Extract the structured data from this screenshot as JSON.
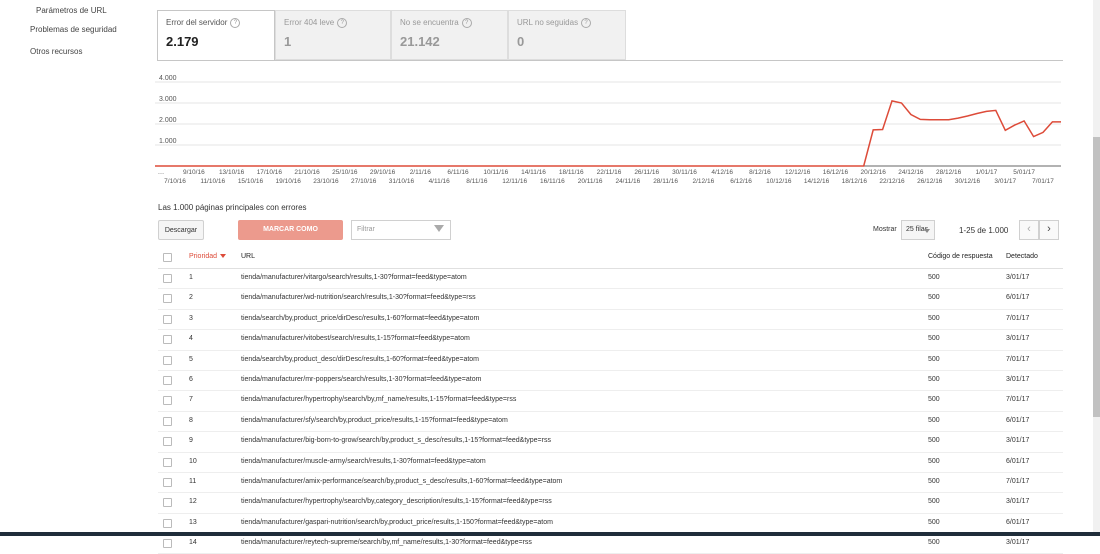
{
  "sidebar": {
    "items": [
      {
        "label": "Parámetros de URL"
      },
      {
        "label": "Problemas de seguridad"
      },
      {
        "label": "Otros recursos"
      }
    ]
  },
  "tabs": [
    {
      "label": "Error del servidor",
      "value": "2.179",
      "active": true
    },
    {
      "label": "Error 404 leve",
      "value": "1",
      "active": false
    },
    {
      "label": "No se encuentra",
      "value": "21.142",
      "active": false
    },
    {
      "label": "URL no seguidas",
      "value": "0",
      "active": false
    }
  ],
  "help_icon": "?",
  "chart_data": {
    "type": "line",
    "y_ticks": [
      "1.000",
      "2.000",
      "3.000",
      "4.000"
    ],
    "ylim": [
      0,
      4000
    ],
    "grid": true,
    "x_labels_top": [
      "…",
      "9/10/16",
      "13/10/16",
      "17/10/16",
      "21/10/16",
      "25/10/16",
      "29/10/16",
      "2/11/16",
      "6/11/16",
      "10/11/16",
      "14/11/16",
      "18/11/16",
      "22/11/16",
      "26/11/16",
      "30/11/16",
      "4/12/16",
      "8/12/16",
      "12/12/16",
      "16/12/16",
      "20/12/16",
      "24/12/16",
      "28/12/16",
      "1/01/17",
      "5/01/17"
    ],
    "x_labels_bottom": [
      "7/10/16",
      "11/10/16",
      "15/10/16",
      "19/10/16",
      "23/10/16",
      "27/10/16",
      "31/10/16",
      "4/11/16",
      "8/11/16",
      "12/11/16",
      "16/11/16",
      "20/11/16",
      "24/11/16",
      "28/11/16",
      "2/12/16",
      "6/12/16",
      "10/12/16",
      "14/12/16",
      "18/12/16",
      "22/12/16",
      "26/12/16",
      "30/12/16",
      "3/01/17",
      "7/01/17"
    ],
    "series": [
      {
        "color": "#dd4b39",
        "x": [
          "7/10/16",
          "18/12/16",
          "19/12/16",
          "20/12/16",
          "21/12/16",
          "22/12/16",
          "23/12/16",
          "24/12/16",
          "25/12/16",
          "26/12/16",
          "27/12/16",
          "28/12/16",
          "29/12/16",
          "30/12/16",
          "31/12/16",
          "1/01/17",
          "2/01/17",
          "3/01/17",
          "4/01/17",
          "5/01/17",
          "6/01/17",
          "7/01/17",
          "8/01/17"
        ],
        "values": [
          0,
          0,
          0,
          1720,
          1740,
          3100,
          3000,
          2450,
          2220,
          2200,
          2200,
          2200,
          2280,
          2380,
          2500,
          2600,
          2650,
          1700,
          1950,
          2150,
          1400,
          1600,
          2100
        ]
      }
    ]
  },
  "section_title": "Las 1.000 páginas principales con errores",
  "toolbar": {
    "download_label": "Descargar",
    "mark_fixed_label": "MARCAR COMO SOLUCIONADOS (0)",
    "filter_placeholder": "Filtrar",
    "show_label": "Mostrar",
    "rows_per_page": "25 filas",
    "range": "1-25 de 1.000",
    "prev": "‹",
    "next": "›"
  },
  "table": {
    "headers": {
      "priority": "Prioridad",
      "url": "URL",
      "code": "Código de respuesta",
      "detected": "Detectado"
    },
    "rows": [
      {
        "priority": "1",
        "url": "tienda/manufacturer/vitargo/search/results,1-30?format=feed&type=atom",
        "code": "500",
        "detected": "3/01/17"
      },
      {
        "priority": "2",
        "url": "tienda/manufacturer/wd-nutrition/search/results,1-30?format=feed&type=rss",
        "code": "500",
        "detected": "6/01/17"
      },
      {
        "priority": "3",
        "url": "tienda/search/by,product_price/dirDesc/results,1-60?format=feed&type=atom",
        "code": "500",
        "detected": "7/01/17"
      },
      {
        "priority": "4",
        "url": "tienda/manufacturer/vitobest/search/results,1-15?format=feed&type=atom",
        "code": "500",
        "detected": "3/01/17"
      },
      {
        "priority": "5",
        "url": "tienda/search/by,product_desc/dirDesc/results,1-60?format=feed&type=atom",
        "code": "500",
        "detected": "7/01/17"
      },
      {
        "priority": "6",
        "url": "tienda/manufacturer/mr-poppers/search/results,1-30?format=feed&type=atom",
        "code": "500",
        "detected": "3/01/17"
      },
      {
        "priority": "7",
        "url": "tienda/manufacturer/hypertrophy/search/by,mf_name/results,1-15?format=feed&type=rss",
        "code": "500",
        "detected": "7/01/17"
      },
      {
        "priority": "8",
        "url": "tienda/manufacturer/sfy/search/by,product_price/results,1-15?format=feed&type=atom",
        "code": "500",
        "detected": "6/01/17"
      },
      {
        "priority": "9",
        "url": "tienda/manufacturer/big-born-to-grow/search/by,product_s_desc/results,1-15?format=feed&type=rss",
        "code": "500",
        "detected": "3/01/17"
      },
      {
        "priority": "10",
        "url": "tienda/manufacturer/muscle-army/search/results,1-30?format=feed&type=atom",
        "code": "500",
        "detected": "6/01/17"
      },
      {
        "priority": "11",
        "url": "tienda/manufacturer/amix-performance/search/by,product_s_desc/results,1-60?format=feed&type=atom",
        "code": "500",
        "detected": "7/01/17"
      },
      {
        "priority": "12",
        "url": "tienda/manufacturer/hypertrophy/search/by,category_description/results,1-15?format=feed&type=rss",
        "code": "500",
        "detected": "3/01/17"
      },
      {
        "priority": "13",
        "url": "tienda/manufacturer/gaspari-nutrition/search/by,product_price/results,1-150?format=feed&type=atom",
        "code": "500",
        "detected": "6/01/17"
      },
      {
        "priority": "14",
        "url": "tienda/manufacturer/reytech-supreme/search/by,mf_name/results,1-30?format=feed&type=rss",
        "code": "500",
        "detected": "3/01/17"
      }
    ]
  }
}
